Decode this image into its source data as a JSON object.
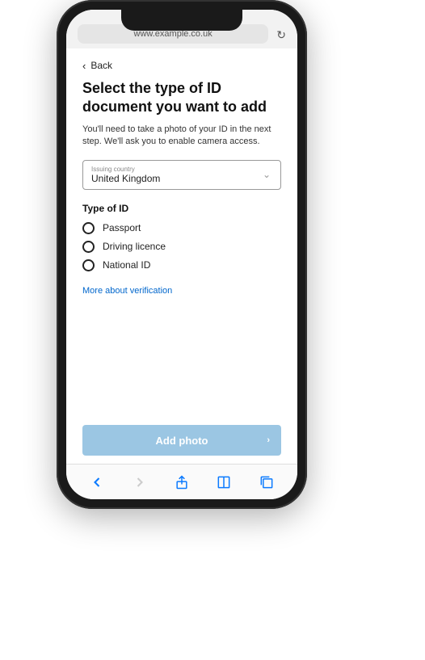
{
  "browser": {
    "url": "www.example.co.uk"
  },
  "nav": {
    "back_label": "Back"
  },
  "page": {
    "title": "Select the type of ID document you want to add",
    "subtitle": "You'll need to take a photo of your ID in the next step. We'll ask you to enable camera access."
  },
  "country": {
    "label": "Issuing country",
    "value": "United Kingdom"
  },
  "id_type": {
    "section_label": "Type of ID",
    "options": [
      "Passport",
      "Driving licence",
      "National ID"
    ]
  },
  "links": {
    "more": "More about verification"
  },
  "cta": {
    "label": "Add photo"
  }
}
